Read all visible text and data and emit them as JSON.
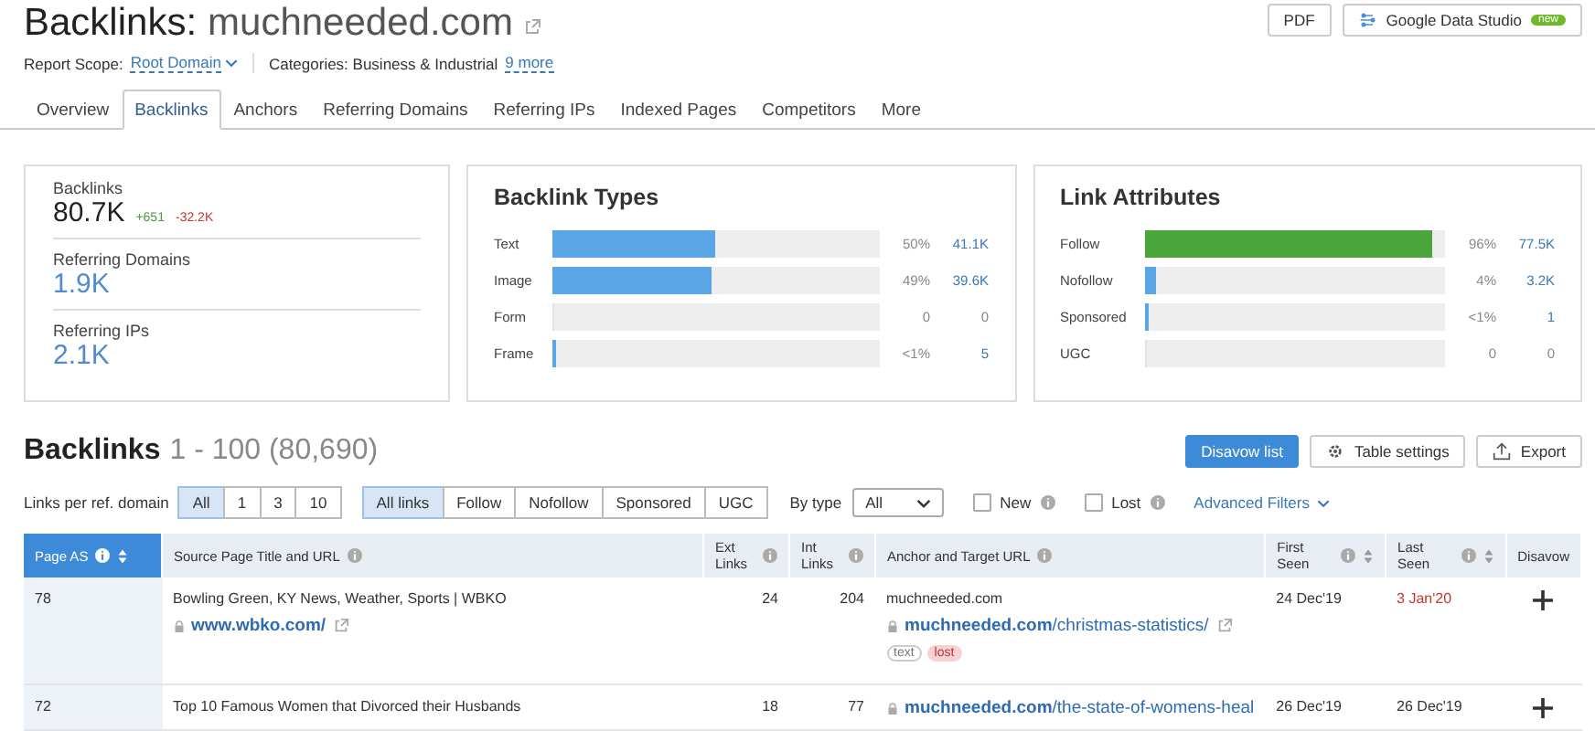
{
  "header": {
    "title": "Backlinks:",
    "domain": "muchneeded.com",
    "buttons": [
      {
        "label": "PDF",
        "kind": "pdf"
      },
      {
        "label": "Google Data Studio",
        "kind": "studio",
        "badge": "new"
      }
    ],
    "scope_label": "Report Scope:",
    "scope_value": "Root Domain",
    "categories": "Categories: Business & Industrial",
    "categories_more": "9 more"
  },
  "tabs": [
    {
      "label": "Overview",
      "selected": false
    },
    {
      "label": "Backlinks",
      "selected": true
    },
    {
      "label": "Anchors",
      "selected": false
    },
    {
      "label": "Referring Domains",
      "selected": false
    },
    {
      "label": "Referring IPs",
      "selected": false
    },
    {
      "label": "Indexed Pages",
      "selected": false
    },
    {
      "label": "Competitors",
      "selected": false
    },
    {
      "label": "More",
      "selected": false
    }
  ],
  "summary": [
    {
      "label": "Backlinks",
      "value": "80.7K",
      "kind": "dark",
      "deltas": [
        {
          "text": "+651",
          "kind": "up"
        },
        {
          "text": "-32.2K",
          "kind": "down"
        }
      ]
    },
    {
      "label": "Referring Domains",
      "value": "1.9K",
      "kind": "link"
    },
    {
      "label": "Referring IPs",
      "value": "2.1K",
      "kind": "link"
    }
  ],
  "panels": [
    {
      "title": "Backlink Types",
      "rows": [
        {
          "label": "Text",
          "level": 0.5,
          "color": "#5aa5e6",
          "percent": "50%",
          "count": "41.1K"
        },
        {
          "label": "Image",
          "level": 0.49,
          "color": "#5aa5e6",
          "percent": "49%",
          "count": "39.6K"
        },
        {
          "label": "Form",
          "level": 0,
          "percent": "0",
          "count": "0"
        },
        {
          "label": "Frame",
          "level": 0.005,
          "color": "#5aa5e6",
          "percent": "<1%",
          "count": "5"
        }
      ]
    },
    {
      "title": "Link Attributes",
      "rows": [
        {
          "label": "Follow",
          "level": 0.96,
          "color": "#4aa63a",
          "percent": "96%",
          "count": "77.5K"
        },
        {
          "label": "Nofollow",
          "level": 0.04,
          "color": "#5aa5e6",
          "percent": "4%",
          "count": "3.2K"
        },
        {
          "label": "Sponsored",
          "level": 0.005,
          "color": "#5aa5e6",
          "percent": "<1%",
          "count": "1"
        },
        {
          "label": "UGC",
          "level": 0,
          "percent": "0",
          "count": "0"
        }
      ]
    }
  ],
  "backlinks": {
    "title": "Backlinks",
    "range": "1 - 100 (80,690)",
    "buttons": [
      {
        "label": "Disavow list",
        "kind": "primary"
      },
      {
        "label": "Table settings",
        "kind": "settings"
      },
      {
        "label": "Export",
        "kind": "export"
      }
    ]
  },
  "filters": {
    "per_domain_label": "Links per ref. domain",
    "per_domain": [
      {
        "label": "All",
        "selected": true
      },
      {
        "label": "1",
        "selected": false
      },
      {
        "label": "3",
        "selected": false
      },
      {
        "label": "10",
        "selected": false
      }
    ],
    "link_types": [
      {
        "label": "All links",
        "selected": true
      },
      {
        "label": "Follow",
        "selected": false
      },
      {
        "label": "Nofollow",
        "selected": false
      },
      {
        "label": "Sponsored",
        "selected": false
      },
      {
        "label": "UGC",
        "selected": false
      }
    ],
    "by_type_label": "By type",
    "by_type_value": "All",
    "checkboxes": [
      {
        "label": "New",
        "checked": false
      },
      {
        "label": "Lost",
        "checked": false
      }
    ],
    "advanced": "Advanced Filters"
  },
  "table": {
    "columns": [
      {
        "label": "Page AS",
        "info": true,
        "sortable": true,
        "selected": true,
        "kind": "page"
      },
      {
        "label": "Source Page Title and URL",
        "info": true,
        "sortable": false,
        "selected": false,
        "kind": "source"
      },
      {
        "label": "Ext Links",
        "info": true,
        "sortable": false,
        "selected": false,
        "kind": "num"
      },
      {
        "label": "Int Links",
        "info": true,
        "sortable": false,
        "selected": false,
        "kind": "num"
      },
      {
        "label": "Anchor and Target URL",
        "info": true,
        "sortable": false,
        "selected": false,
        "kind": "anchor"
      },
      {
        "label": "First Seen",
        "info": true,
        "sortable": true,
        "selected": false,
        "kind": "date"
      },
      {
        "label": "Last Seen",
        "info": true,
        "sortable": true,
        "selected": false,
        "kind": "date"
      },
      {
        "label": "Disavow",
        "info": false,
        "sortable": false,
        "selected": false,
        "kind": "action"
      }
    ],
    "rows": [
      {
        "page_as": "78",
        "title": "Bowling Green, KY News, Weather, Sports | WBKO",
        "url": "www.wbko.com/",
        "ext": "24",
        "int": "204",
        "anchor": "muchneeded.com",
        "target_domain": "muchneeded.com",
        "target_path": "/christmas-statistics/",
        "tags": [
          {
            "text": "text",
            "kind": "plain"
          },
          {
            "text": "lost",
            "kind": "lost"
          }
        ],
        "first_seen": "24 Dec'19",
        "last_seen": "3 Jan'20",
        "lost": true
      },
      {
        "page_as": "72",
        "title": "Top 10 Famous Women that Divorced their Husbands",
        "url": "",
        "ext": "18",
        "int": "77",
        "anchor": "",
        "target_domain": "muchneeded.com",
        "target_path": "/the-state-of-womens-heal",
        "tags": [],
        "first_seen": "26 Dec'19",
        "last_seen": "26 Dec'19",
        "lost": false
      }
    ]
  }
}
